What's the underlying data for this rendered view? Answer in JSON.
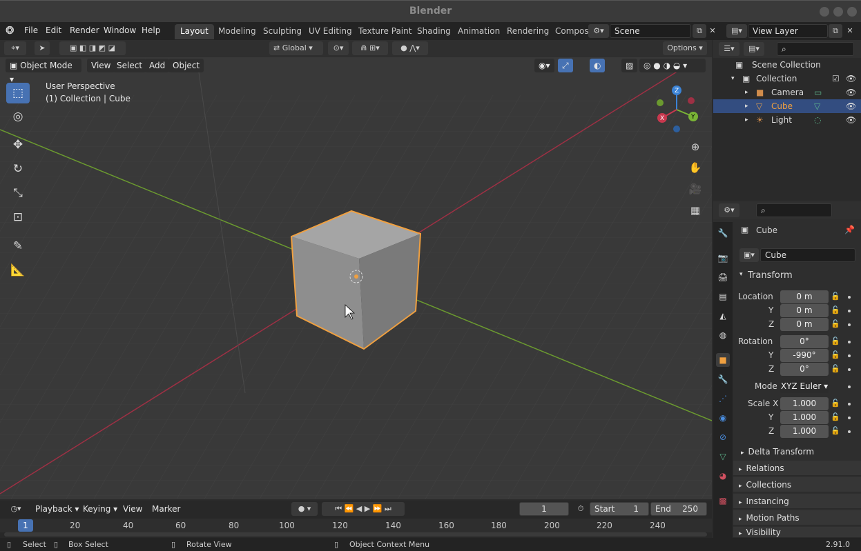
{
  "window": {
    "title": "Blender"
  },
  "menu": [
    "File",
    "Edit",
    "Render",
    "Window",
    "Help"
  ],
  "workspaces": [
    "Layout",
    "Modeling",
    "Sculpting",
    "UV Editing",
    "Texture Paint",
    "Shading",
    "Animation",
    "Rendering",
    "Compos"
  ],
  "scene": {
    "name": "Scene"
  },
  "view_layer": {
    "name": "View Layer"
  },
  "viewport_header": {
    "mode": "Object Mode",
    "menus": [
      "View",
      "Select",
      "Add",
      "Object"
    ],
    "orientation": "Global",
    "options": "Options"
  },
  "viewport_info": {
    "perspective": "User Perspective",
    "collection": "(1) Collection | Cube"
  },
  "outliner": {
    "root": "Scene Collection",
    "collection": "Collection",
    "items": [
      "Camera",
      "Cube",
      "Light"
    ]
  },
  "properties": {
    "object_name": "Cube",
    "data_name": "Cube",
    "transform_title": "Transform",
    "location_label": "Location",
    "rotation_label": "Rotation",
    "mode_label": "Mode",
    "scale_label": "Scale X",
    "y_label": "Y",
    "z_label": "Z",
    "location": [
      "0 m",
      "0 m",
      "0 m"
    ],
    "rotation": [
      "0°",
      "-990°",
      "0°"
    ],
    "rotation_mode": "XYZ Euler",
    "scale": [
      "1.000",
      "1.000",
      "1.000"
    ],
    "subsections": [
      "Delta Transform",
      "Relations",
      "Collections",
      "Instancing",
      "Motion Paths",
      "Visibility"
    ]
  },
  "timeline": {
    "menus": [
      "Playback",
      "Keying",
      "View",
      "Marker"
    ],
    "current_frame": "1",
    "start_label": "Start",
    "start": "1",
    "end_label": "End",
    "end": "250",
    "ruler": [
      "1",
      "20",
      "40",
      "60",
      "80",
      "100",
      "120",
      "140",
      "160",
      "180",
      "200",
      "220",
      "240"
    ]
  },
  "status": {
    "select": "Select",
    "box_select": "Box Select",
    "rotate": "Rotate View",
    "context": "Object Context Menu",
    "version": "2.91.0"
  },
  "colors": {
    "accent": "#4772b3",
    "selection": "#f0a040",
    "x_axis": "#c8384e",
    "y_axis": "#7ab536",
    "z_axis": "#3b83d6"
  }
}
